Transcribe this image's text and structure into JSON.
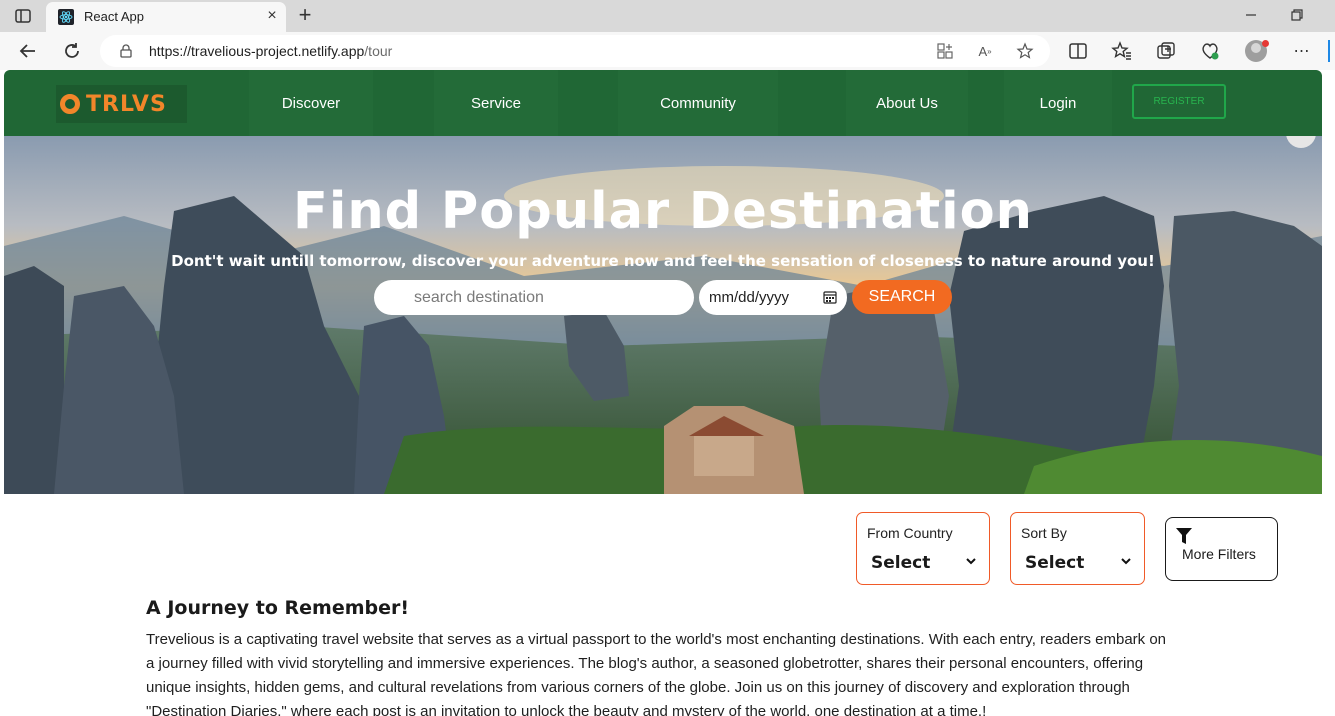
{
  "browser": {
    "tab_title": "React App",
    "url_host": "https://travelious-project.netlify.app",
    "url_path": "/tour",
    "icons": [
      "sidebar-toggle-icon",
      "react-favicon-icon",
      "close-icon",
      "plus-icon",
      "minimize-icon",
      "restore-icon",
      "back-icon",
      "refresh-icon",
      "lock-icon",
      "app-install-icon",
      "read-aloud-icon",
      "favorite-star-icon",
      "split-screen-icon",
      "favorites-icon",
      "collections-icon",
      "browser-essentials-icon",
      "profile-avatar-icon",
      "more-icon"
    ]
  },
  "nav": {
    "logo_text": "TRLVS",
    "items": [
      "Discover",
      "Service",
      "Community",
      "About Us",
      "Login"
    ],
    "register_label": "REGISTER"
  },
  "hero": {
    "title": "Find Popular Destination",
    "subtitle": "Dont't wait untill tomorrow, discover your adventure now and feel the sensation of closeness to nature around you!",
    "search_placeholder": "search destination",
    "date_placeholder": "mm/dd/yyyy",
    "search_button": "SEARCH"
  },
  "filters": {
    "from_country": {
      "label": "From Country",
      "value": "Select"
    },
    "sort_by": {
      "label": "Sort By",
      "value": "Select"
    },
    "more_filters": "More Filters"
  },
  "article": {
    "title": "A Journey to Remember!",
    "body": "Trevelious is a captivating travel website that serves as a virtual passport to the world's most enchanting destinations. With each entry, readers embark on a journey filled with vivid storytelling and immersive experiences. The blog's author, a seasoned globetrotter, shares their personal encounters, offering unique insights, hidden gems, and cultural revelations from various corners of the globe. Join us on this journey of discovery and exploration through \"Destination Diaries,\" where each post is an invitation to unlock the beauty and mystery of the world, one destination at a time.!"
  },
  "colors": {
    "nav_green": "#206735",
    "accent_orange": "#f26a21",
    "logo_orange": "#f2862a",
    "filter_border": "#f05a28"
  }
}
